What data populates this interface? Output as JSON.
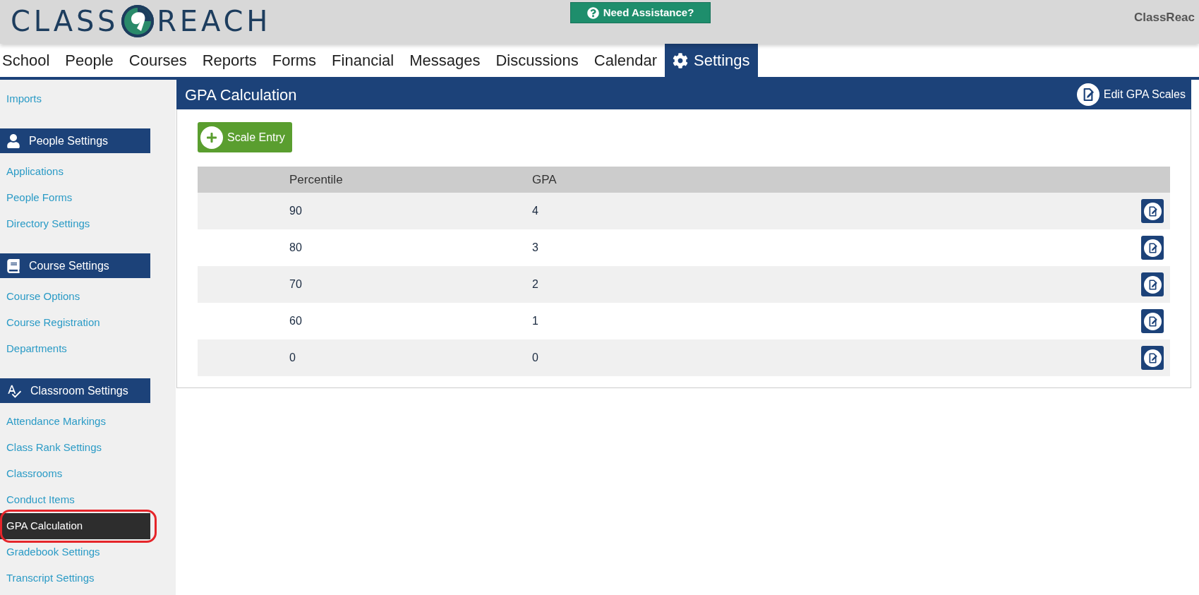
{
  "header": {
    "logo": {
      "left": "CLASS",
      "right": "REACH"
    },
    "help_button": "Need Assistance?",
    "account": "ClassReac"
  },
  "nav": {
    "tabs": [
      {
        "label": "School",
        "selected": false
      },
      {
        "label": "People",
        "selected": false
      },
      {
        "label": "Courses",
        "selected": false
      },
      {
        "label": "Reports",
        "selected": false
      },
      {
        "label": "Forms",
        "selected": false
      },
      {
        "label": "Financial",
        "selected": false
      },
      {
        "label": "Messages",
        "selected": false
      },
      {
        "label": "Discussions",
        "selected": false
      },
      {
        "label": "Calendar",
        "selected": false
      },
      {
        "label": "Settings",
        "selected": true
      }
    ]
  },
  "sidebar": {
    "top_items": [
      {
        "label": "Imports",
        "selected": false,
        "highlighted": false
      }
    ],
    "sections": [
      {
        "kind": "person",
        "title": "People Settings",
        "items": [
          {
            "label": "Applications",
            "selected": false,
            "highlighted": false
          },
          {
            "label": "People Forms",
            "selected": false,
            "highlighted": false
          },
          {
            "label": "Directory Settings",
            "selected": false,
            "highlighted": false
          }
        ]
      },
      {
        "kind": "book",
        "title": "Course Settings",
        "items": [
          {
            "label": "Course Options",
            "selected": false,
            "highlighted": false
          },
          {
            "label": "Course Registration",
            "selected": false,
            "highlighted": false
          },
          {
            "label": "Departments",
            "selected": false,
            "highlighted": false
          }
        ]
      },
      {
        "kind": "spellcheck",
        "title": "Classroom Settings",
        "items": [
          {
            "label": "Attendance Markings",
            "selected": false,
            "highlighted": false
          },
          {
            "label": "Class Rank Settings",
            "selected": false,
            "highlighted": false
          },
          {
            "label": "Classrooms",
            "selected": false,
            "highlighted": false
          },
          {
            "label": "Conduct Items",
            "selected": false,
            "highlighted": false
          },
          {
            "label": "GPA Calculation",
            "selected": true,
            "highlighted": true
          },
          {
            "label": "Gradebook Settings",
            "selected": false,
            "highlighted": false
          },
          {
            "label": "Transcript Settings",
            "selected": false,
            "highlighted": false
          }
        ]
      }
    ]
  },
  "panel": {
    "title": "GPA Calculation",
    "header_button": "Edit GPA Scales",
    "add_button": "Scale Entry",
    "table": {
      "columns": [
        "Percentile",
        "GPA"
      ],
      "rows": [
        {
          "cells": [
            "90",
            "4"
          ]
        },
        {
          "cells": [
            "80",
            "3"
          ]
        },
        {
          "cells": [
            "70",
            "2"
          ]
        },
        {
          "cells": [
            "60",
            "1"
          ]
        },
        {
          "cells": [
            "0",
            "0"
          ]
        }
      ]
    }
  }
}
